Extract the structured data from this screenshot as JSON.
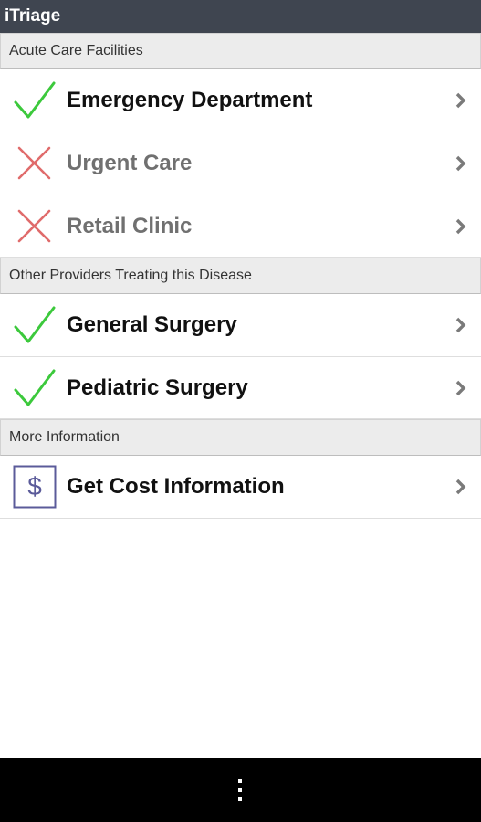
{
  "app": {
    "title": "iTriage"
  },
  "sections": [
    {
      "header": "Acute Care Facilities",
      "items": [
        {
          "label": "Emergency Department",
          "status": "check-icon"
        },
        {
          "label": "Urgent Care",
          "status": "cross-icon"
        },
        {
          "label": "Retail Clinic",
          "status": "cross-icon"
        }
      ]
    },
    {
      "header": "Other Providers Treating this Disease",
      "items": [
        {
          "label": "General Surgery",
          "status": "check-icon"
        },
        {
          "label": "Pediatric Surgery",
          "status": "check-icon"
        }
      ]
    },
    {
      "header": "More Information",
      "items": [
        {
          "label": "Get Cost Information",
          "status": "dollar-icon"
        }
      ]
    }
  ],
  "colors": {
    "titlebar": "#3f4550",
    "check": "#3cc93c",
    "cross": "#e06b6b",
    "dollar": "#5b5b9a",
    "section_bg": "#ececec"
  },
  "navbar": {
    "menu": "overflow-menu-icon"
  }
}
